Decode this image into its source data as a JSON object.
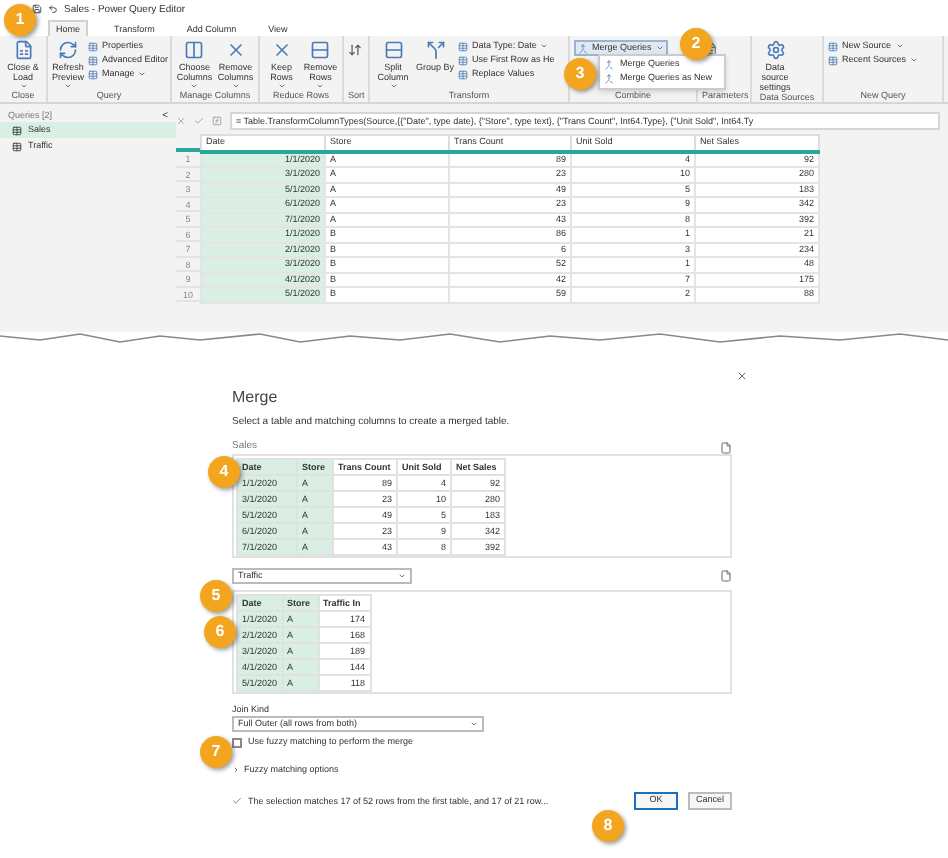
{
  "window": {
    "title": "Sales - Power Query Editor"
  },
  "tabs": [
    {
      "label": "Home",
      "selected": true
    },
    {
      "label": "Transform",
      "selected": false
    },
    {
      "label": "Add Column",
      "selected": false
    },
    {
      "label": "View",
      "selected": false
    }
  ],
  "ribbon": [
    {
      "name": "Close",
      "items": [
        {
          "kind": "large",
          "label": "Close & Load",
          "dropdown": true
        }
      ]
    },
    {
      "name": "Query",
      "items": [
        {
          "kind": "large",
          "label": "Refresh Preview",
          "dropdown": true
        },
        {
          "kind": "small",
          "label": "Properties",
          "dropdown": false
        },
        {
          "kind": "small",
          "label": "Advanced Editor",
          "dropdown": false
        },
        {
          "kind": "small",
          "label": "Manage",
          "dropdown": true
        }
      ]
    },
    {
      "name": "Manage Columns",
      "items": [
        {
          "kind": "large",
          "label": "Choose Columns",
          "dropdown": true
        },
        {
          "kind": "large",
          "label": "Remove Columns",
          "dropdown": true
        }
      ]
    },
    {
      "name": "Reduce Rows",
      "items": [
        {
          "kind": "large",
          "label": "Keep Rows",
          "dropdown": true
        },
        {
          "kind": "large",
          "label": "Remove Rows",
          "dropdown": true
        }
      ]
    },
    {
      "name": "Sort"
    },
    {
      "name": "Transform",
      "items": [
        {
          "kind": "large",
          "label": "Split Column",
          "dropdown": true
        },
        {
          "kind": "large",
          "label": "Group By",
          "dropdown": false
        },
        {
          "kind": "small",
          "label": "Data Type: Date",
          "dropdown": true
        },
        {
          "kind": "small",
          "label": "Use First Row as He",
          "dropdown": false
        },
        {
          "kind": "small",
          "label": "Replace Values",
          "dropdown": false
        }
      ]
    },
    {
      "name": "Combine",
      "items": [
        {
          "kind": "small",
          "label": "Merge Queries",
          "dropdown": true
        }
      ]
    },
    {
      "name": "Parameters"
    },
    {
      "name": "Data Sources",
      "items": [
        {
          "kind": "large",
          "label": "Data source settings",
          "dropdown": false
        }
      ]
    },
    {
      "name": "New Query",
      "items": [
        {
          "kind": "small",
          "label": "New Source",
          "dropdown": true
        },
        {
          "kind": "small",
          "label": "Recent Sources",
          "dropdown": true
        }
      ]
    }
  ],
  "merge_menu": [
    "Merge Queries",
    "Merge Queries as New"
  ],
  "queries_pane": {
    "title": "Queries [2]",
    "collapse": "<",
    "items": [
      {
        "label": "Sales",
        "selected": true
      },
      {
        "label": "Traffic",
        "selected": false
      }
    ]
  },
  "formula_bar": {
    "formula": "= Table.TransformColumnTypes(Source,{{\"Date\", type date}, {\"Store\", type text}, {\"Trans Count\", Int64.Type}, {\"Unit Sold\", Int64.Ty"
  },
  "grid": {
    "columns": [
      "Date",
      "Store",
      "Trans Count",
      "Unit Sold",
      "Net Sales"
    ],
    "rows": [
      {
        "number": "1",
        "cells": [
          "1/1/2020",
          "A",
          "89",
          "4",
          "92"
        ]
      },
      {
        "number": "2",
        "cells": [
          "3/1/2020",
          "A",
          "23",
          "10",
          "280"
        ]
      },
      {
        "number": "3",
        "cells": [
          "5/1/2020",
          "A",
          "49",
          "5",
          "183"
        ]
      },
      {
        "number": "4",
        "cells": [
          "6/1/2020",
          "A",
          "23",
          "9",
          "342"
        ]
      },
      {
        "number": "5",
        "cells": [
          "7/1/2020",
          "A",
          "43",
          "8",
          "392"
        ]
      },
      {
        "number": "6",
        "cells": [
          "1/1/2020",
          "B",
          "86",
          "1",
          "21"
        ]
      },
      {
        "number": "7",
        "cells": [
          "2/1/2020",
          "B",
          "6",
          "3",
          "234"
        ]
      },
      {
        "number": "8",
        "cells": [
          "3/1/2020",
          "B",
          "52",
          "1",
          "48"
        ]
      },
      {
        "number": "9",
        "cells": [
          "4/1/2020",
          "B",
          "42",
          "7",
          "175"
        ]
      },
      {
        "number": "10",
        "cells": [
          "5/1/2020",
          "B",
          "59",
          "2",
          "88"
        ]
      }
    ]
  },
  "merge_dialog": {
    "title": "Merge",
    "description": "Select a table and matching columns to create a merged table.",
    "first_table": {
      "label": "Sales",
      "columns": [
        "Date",
        "Store",
        "Trans Count",
        "Unit Sold",
        "Net Sales"
      ],
      "rows": [
        [
          "1/1/2020",
          "A",
          "89",
          "4",
          "92"
        ],
        [
          "3/1/2020",
          "A",
          "23",
          "10",
          "280"
        ],
        [
          "5/1/2020",
          "A",
          "49",
          "5",
          "183"
        ],
        [
          "6/1/2020",
          "A",
          "23",
          "9",
          "342"
        ],
        [
          "7/1/2020",
          "A",
          "43",
          "8",
          "392"
        ]
      ]
    },
    "second_table": {
      "value": "Traffic",
      "columns": [
        "Date",
        "Store",
        "Traffic In"
      ],
      "rows": [
        [
          "1/1/2020",
          "A",
          "174"
        ],
        [
          "2/1/2020",
          "A",
          "168"
        ],
        [
          "3/1/2020",
          "A",
          "189"
        ],
        [
          "4/1/2020",
          "A",
          "144"
        ],
        [
          "5/1/2020",
          "A",
          "118"
        ]
      ]
    },
    "join_kind": {
      "label": "Join Kind",
      "value": "Full Outer (all rows from both)"
    },
    "fuzzy": {
      "label": "Use fuzzy matching to perform the merge",
      "checked": false
    },
    "fuzzy_options": {
      "label": "Fuzzy matching options",
      "expanded": false
    },
    "status": "The selection matches 17 of 52 rows from the first table, and 17 of 21 row...",
    "buttons": [
      "OK",
      "Cancel"
    ]
  },
  "callouts": [
    "1",
    "2",
    "3",
    "4",
    "5",
    "6",
    "7",
    "8"
  ]
}
